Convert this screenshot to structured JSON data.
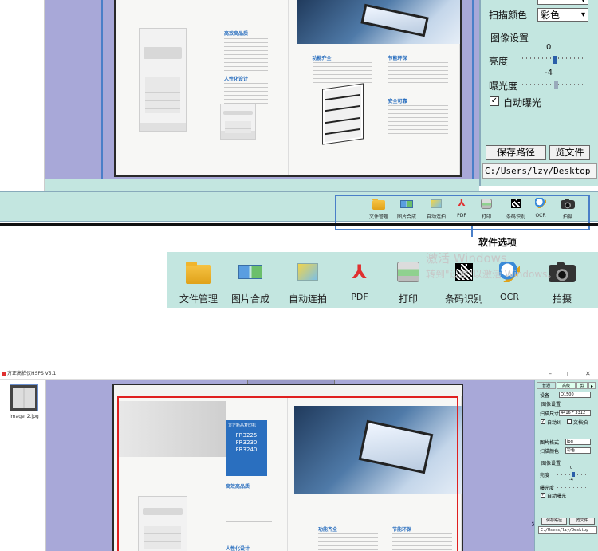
{
  "top_panel": {
    "scan_color_label": "扫描颜色",
    "scan_color_value": "彩色",
    "image_settings_label": "图像设置",
    "brightness_label": "亮度",
    "brightness_value": "0",
    "exposure_label": "曝光度",
    "exposure_value": "-4",
    "auto_exposure_label": "自动曝光",
    "auto_exposure_checked": true,
    "save_path_button": "保存路径",
    "browse_button": "览文件",
    "path_value": "C:/Users/lzy/Desktop"
  },
  "small_toolbar": {
    "items": [
      "文件管理",
      "图片合成",
      "自动连拍",
      "PDF",
      "打印",
      "条码识别",
      "OCR",
      "拍摄"
    ]
  },
  "callout_label": "软件选项",
  "large_toolbar": {
    "items": [
      "文件管理",
      "图片合成",
      "自动连拍",
      "PDF",
      "打印",
      "条码识别",
      "OCR",
      "拍摄"
    ]
  },
  "watermark": {
    "line1": "激活 Windows",
    "line2": "转到\"设置\"以激活 Windows。"
  },
  "window": {
    "title": "方正高拍仪HSPS V5.1",
    "thumbnail_label": "image_2.jpg",
    "min_icon": "–",
    "max_icon": "□",
    "close_icon": "✕"
  },
  "document": {
    "blue_box_lines": [
      "方正新品复印机",
      "FR3225",
      "FR3230",
      "FR3240"
    ],
    "heading_efficient": "高效高品质",
    "heading_humanized": "人性化设计",
    "heading_functions": "功能齐全",
    "heading_eco": "节能环保",
    "heading_safety": "安全可靠"
  },
  "bottom_panel": {
    "tabs": [
      "普通",
      "高级",
      "剪"
    ],
    "device_label": "设备",
    "device_value": "Q1500",
    "image_settings_label": "图像设置",
    "resolution_label": "扫描尺寸",
    "resolution_value": "4416 * 3312",
    "auto_crop_label": "自动纠",
    "doc_fill_label": "文档拍",
    "image_format_label": "图片格式",
    "image_format_value": "jpg",
    "scan_color_label": "扫描颜色",
    "scan_color_value": "彩色",
    "image_settings2_label": "图像设置",
    "brightness_label": "亮度",
    "brightness_value": "0",
    "exposure_label": "曝光度",
    "exposure_value": "-4",
    "auto_exposure_label": "自动曝光",
    "save_path_button": "保存路径",
    "browse_button": "览文件",
    "path_value": "C:/Users/lzy/Desktop",
    "collapse_icon": "»"
  },
  "colors": {
    "panel_bg": "#c3e6e0",
    "preview_bg": "#a8a8d8",
    "selection_border": "#4a7fc8",
    "crop_border": "#e02020",
    "pdf_red": "#e03030"
  }
}
